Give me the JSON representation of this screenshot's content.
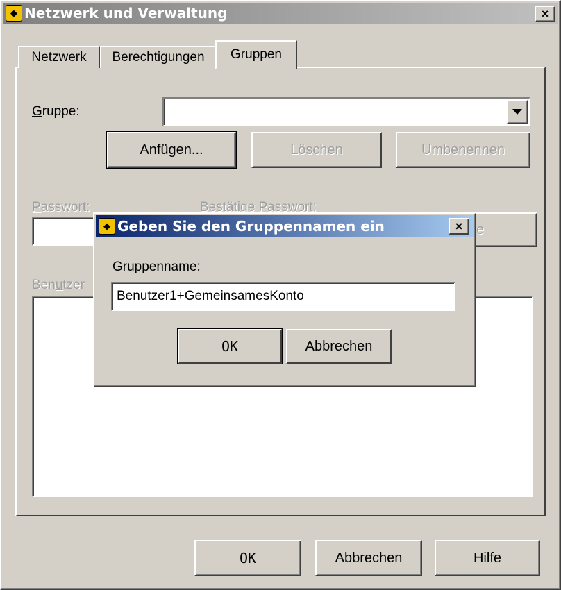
{
  "main_window": {
    "title": "Netzwerk und Verwaltung",
    "close_label": "×",
    "tabs": [
      {
        "label": "Netzwerk"
      },
      {
        "label": "Berechtigungen"
      },
      {
        "label": "Gruppen"
      }
    ],
    "group_label": "Gruppe:",
    "group_label_access_key": "G",
    "group_label_rest": "ruppe:",
    "group_value": "",
    "buttons": {
      "add": "Anfügen...",
      "delete": "Löschen",
      "rename": "Umbenennen"
    },
    "password_label_key": "P",
    "password_label_rest": "asswort:",
    "confirm_password_label": "Bestätige Passwort:",
    "change_button_fragment": "e",
    "users_label_pre": "Ben",
    "users_label_key": "u",
    "users_label_rest": "tzer",
    "footer": {
      "ok": "OK",
      "cancel": "Abbrechen",
      "help": "Hilfe"
    }
  },
  "dialog": {
    "title": "Geben Sie den Gruppennamen ein",
    "close_label": "×",
    "field_label": "Gruppenname:",
    "field_value": "Benutzer1+GemeinsamesKonto",
    "ok": "OK",
    "cancel": "Abbrechen"
  },
  "colors": {
    "face": "#d4d0c8",
    "inactive_title_start": "#808080",
    "inactive_title_end": "#c0c0c0",
    "active_title_start": "#0a246a",
    "active_title_end": "#a6caf0"
  },
  "icons": {
    "app": "app-bat-icon",
    "combo_arrow": "dropdown-arrow-icon"
  }
}
